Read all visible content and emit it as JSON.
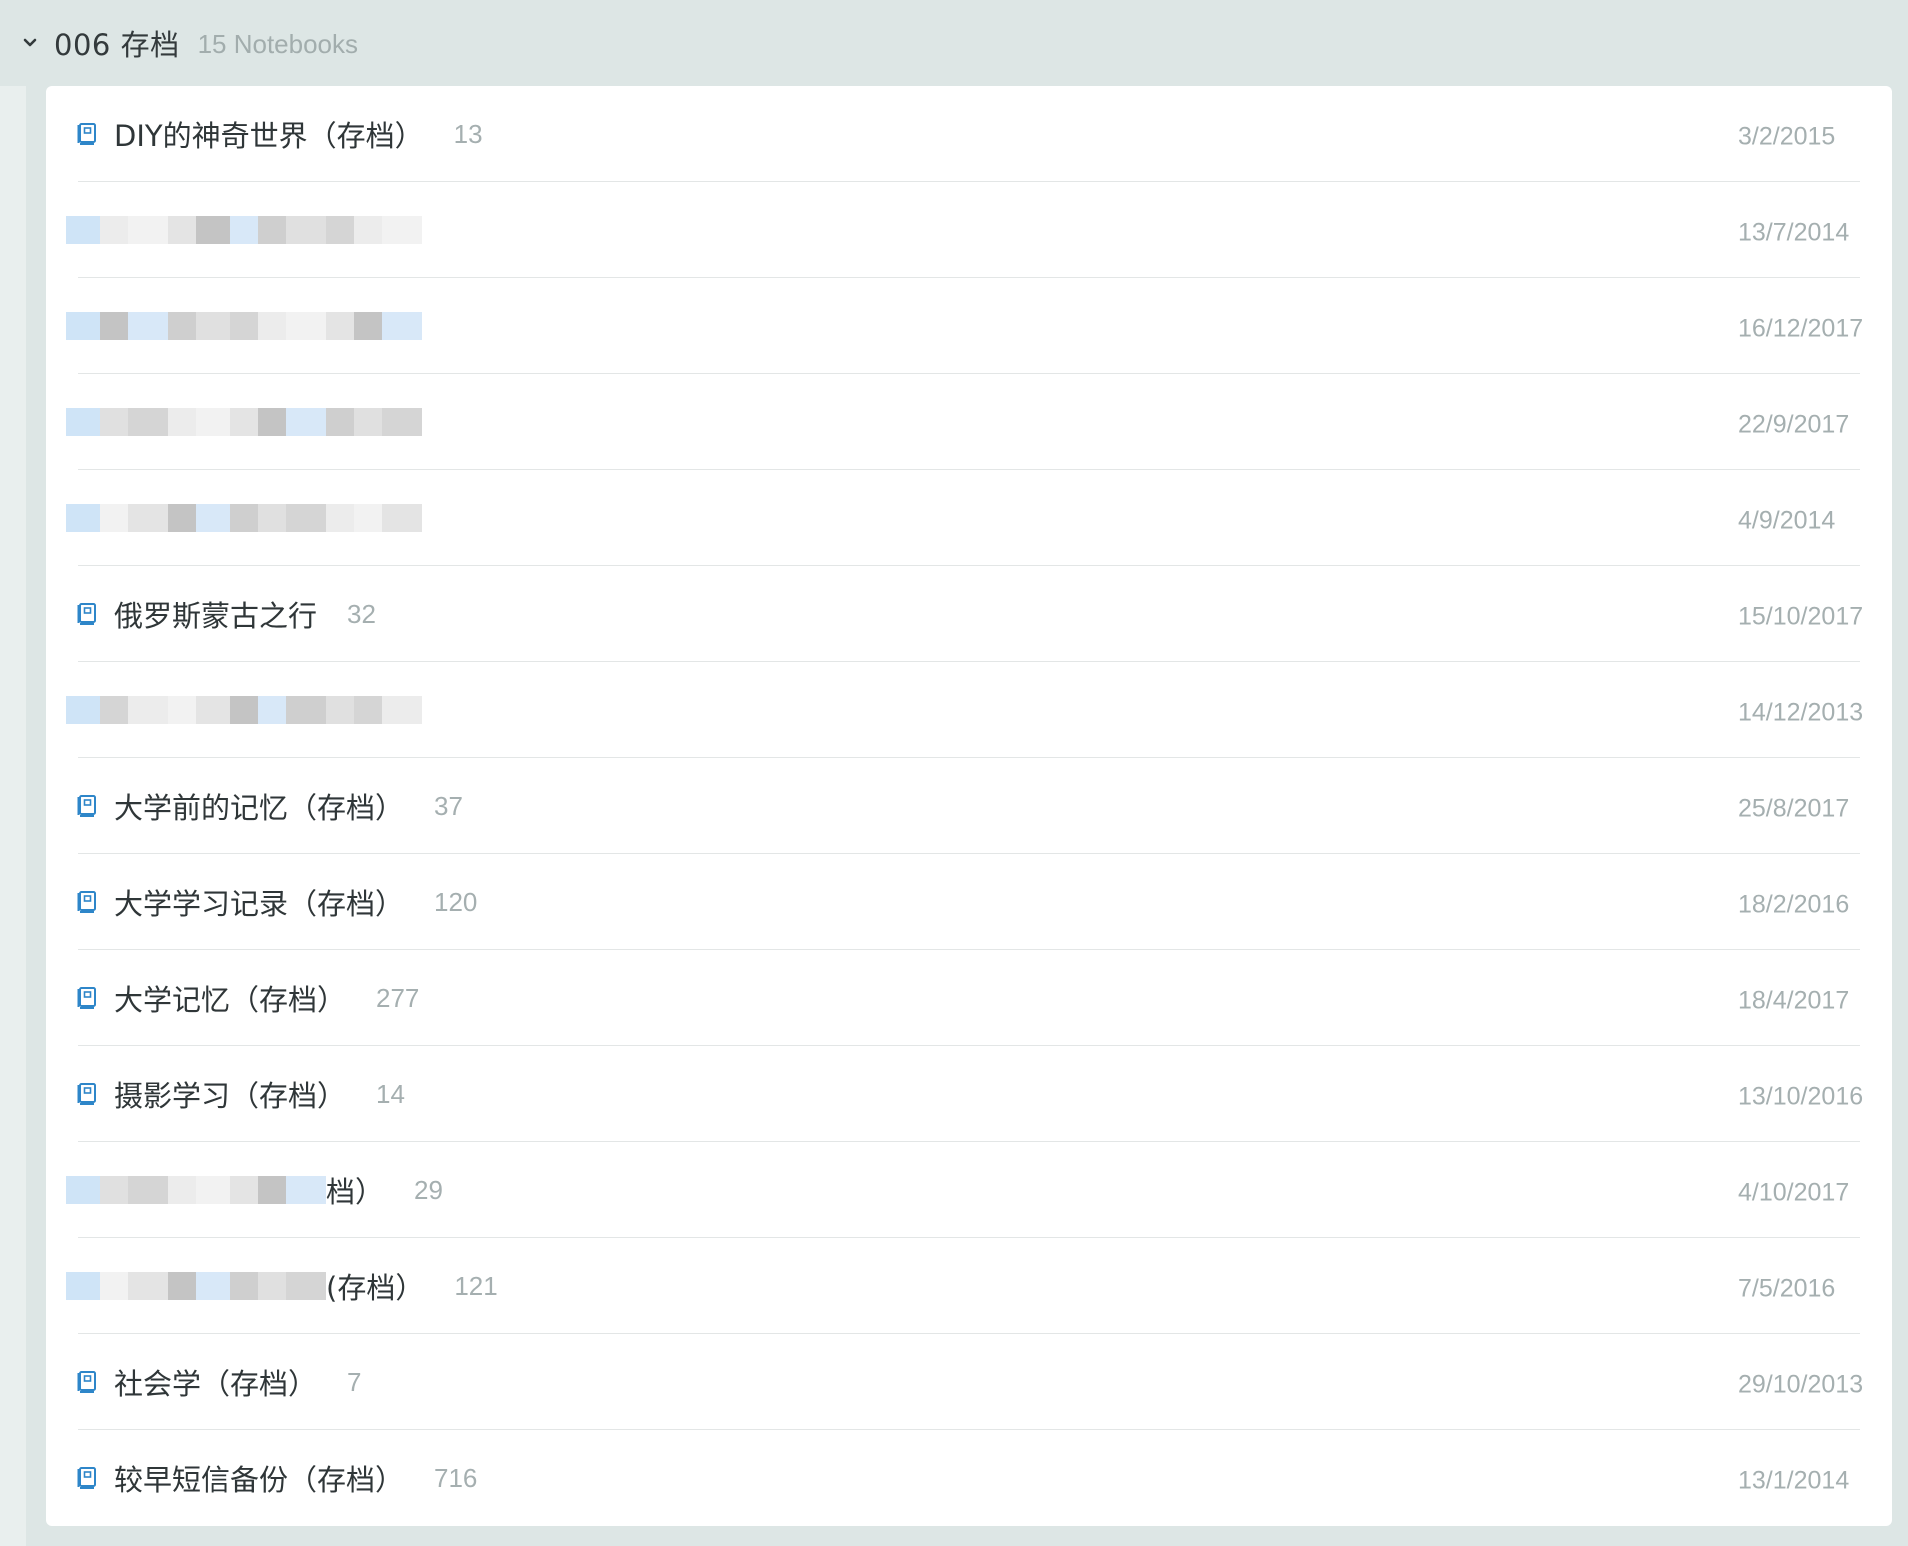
{
  "stack": {
    "title": "006 存档",
    "count_label": "15 Notebooks"
  },
  "colors": {
    "icon_blue": "#2e86c9",
    "date_gray": "#a5afb0",
    "background": "#dde6e5"
  },
  "notebooks": [
    {
      "name": "DIY的神奇世界（存档）",
      "count": "13",
      "date": "3/2/2015",
      "redacted": false
    },
    {
      "name": "",
      "count": "",
      "date": "13/7/2014",
      "redacted": true
    },
    {
      "name": "",
      "count": "",
      "date": "16/12/2017",
      "redacted": true
    },
    {
      "name": "",
      "count": "",
      "date": "22/9/2017",
      "redacted": true
    },
    {
      "name": "",
      "count": "",
      "date": "4/9/2014",
      "redacted": true
    },
    {
      "name": "俄罗斯蒙古之行",
      "count": "32",
      "date": "15/10/2017",
      "redacted": false
    },
    {
      "name": "",
      "count": "",
      "date": "14/12/2013",
      "redacted": true
    },
    {
      "name": "大学前的记忆（存档）",
      "count": "37",
      "date": "25/8/2017",
      "redacted": false
    },
    {
      "name": "大学学习记录（存档）",
      "count": "120",
      "date": "18/2/2016",
      "redacted": false
    },
    {
      "name": "大学记忆（存档）",
      "count": "277",
      "date": "18/4/2017",
      "redacted": false
    },
    {
      "name": "摄影学习（存档）",
      "count": "14",
      "date": "13/10/2016",
      "redacted": false
    },
    {
      "name": "档）",
      "count": "29",
      "date": "4/10/2017",
      "redacted": true
    },
    {
      "name": "(存档）",
      "count": "121",
      "date": "7/5/2016",
      "redacted": true
    },
    {
      "name": "社会学（存档）",
      "count": "7",
      "date": "29/10/2013",
      "redacted": false
    },
    {
      "name": "较早短信备份（存档）",
      "count": "716",
      "date": "13/1/2014",
      "redacted": false
    }
  ],
  "icons": {
    "stack_toggle": "chevron-down-icon",
    "notebook": "notebook-icon"
  }
}
